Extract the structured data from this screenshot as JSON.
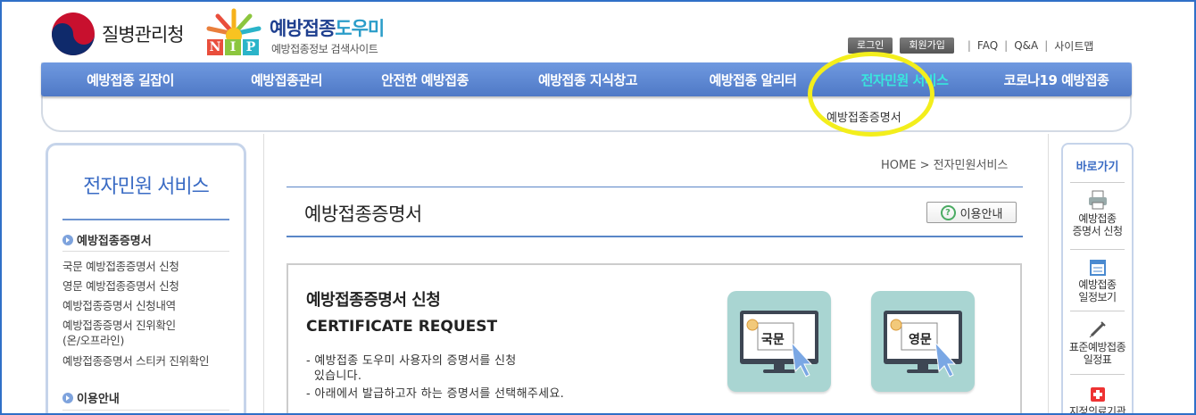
{
  "header": {
    "agency_name": "질병관리청",
    "nip_letters": [
      "N",
      "I",
      "P"
    ],
    "site_title_part1": "예방접종",
    "site_title_part2": "도우미",
    "site_subtitle": "예방접종정보 검색사이트",
    "login_label": "로그인",
    "join_label": "회원가입",
    "links": [
      "FAQ",
      "Q&A",
      "사이트맵"
    ]
  },
  "gnb": {
    "items": [
      "예방접종 길잡이",
      "예방접종관리",
      "안전한 예방접종",
      "예방접종 지식창고",
      "예방접종 알리터",
      "전자민원 서비스",
      "코로나19 예방접종"
    ],
    "active_index": 5,
    "sub_item": "예방접종증명서"
  },
  "sidebar": {
    "title": "전자민원 서비스",
    "section1": "예방접종증명서",
    "links": [
      "국문 예방접종증명서 신청",
      "영문 예방접종증명서 신청",
      "예방접종증명서 신청내역",
      "예방접종증명서 진위확인",
      "(온/오프라인)",
      "예방접종증명서 스티커 진위확인"
    ],
    "section2": "이용안내"
  },
  "breadcrumb": {
    "home": "HOME",
    "separator": ">",
    "current": "전자민원서비스"
  },
  "main": {
    "page_title": "예방접종증명서",
    "guide_label": "이용안내",
    "guide_icon_glyph": "?",
    "cert_title": "예방접종증명서 신청",
    "cert_subtitle": "CERTIFICATE REQUEST",
    "desc_lines": [
      "- 예방접종 도우미 사용자의 증명서를 신청",
      "  있습니다.",
      "- 아래에서 발급하고자 하는 증명서를 선택해주세요."
    ],
    "card_korean": "국문",
    "card_english": "영문"
  },
  "quick": {
    "title": "바로가기",
    "items": [
      {
        "line1": "예방접종",
        "line2": "증명서 신청",
        "icon": "printer-icon"
      },
      {
        "line1": "예방접종",
        "line2": "일정보기",
        "icon": "calendar-icon"
      },
      {
        "line1": "표준예방접종",
        "line2": "일정표",
        "icon": "syringe-icon"
      },
      {
        "line1": "지정의료기관",
        "line2": "",
        "icon": "hospital-icon"
      }
    ]
  },
  "colors": {
    "gnb": "#5a86d2",
    "gnb_active": "#39e6dd",
    "accent_blue": "#3a6bc4",
    "card_bg": "#a9d5d2",
    "highlight": "#f3ee1c"
  }
}
